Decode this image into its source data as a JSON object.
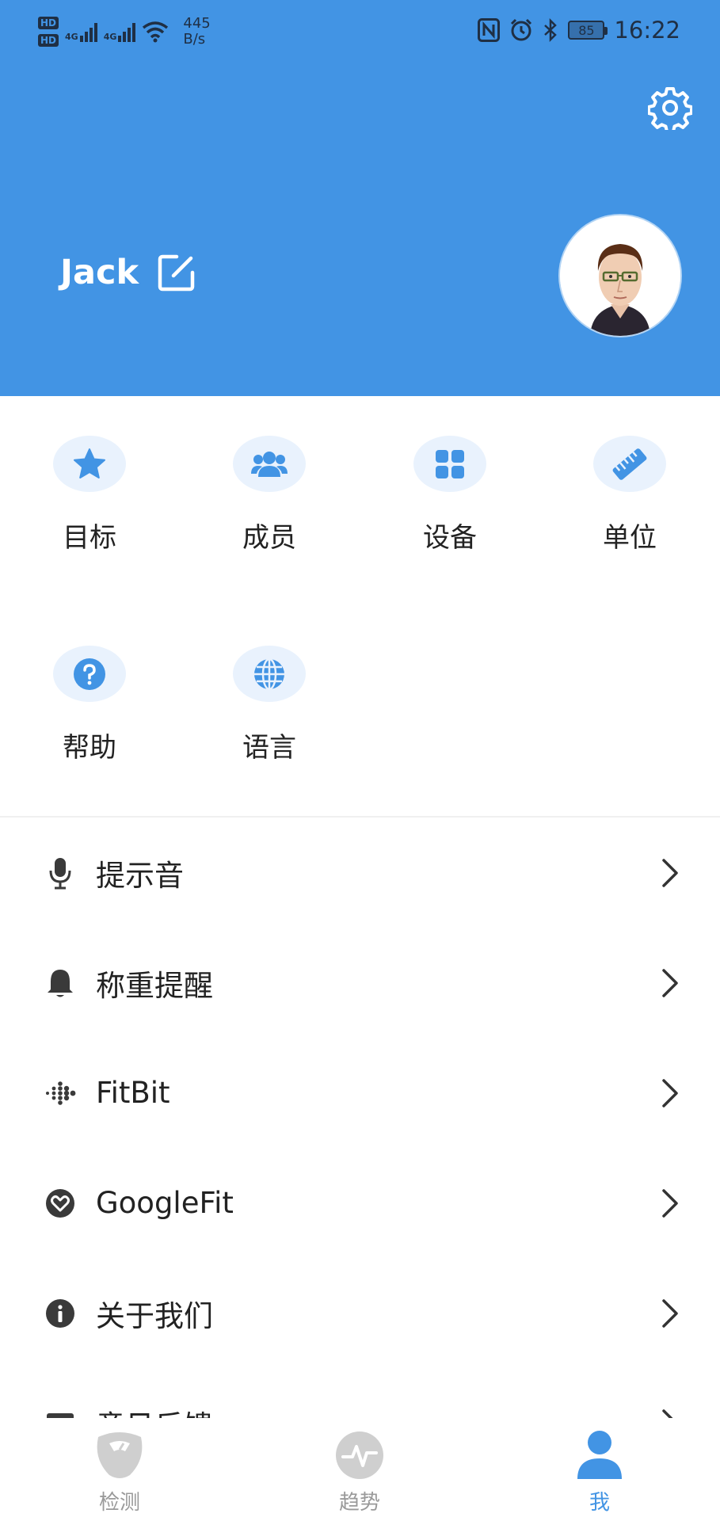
{
  "status_bar": {
    "hd1": "HD",
    "hd2": "HD",
    "net1": "4G",
    "net2": "4G",
    "speed_value": "445",
    "speed_unit": "B/s",
    "battery": "85",
    "time": "16:22"
  },
  "profile": {
    "username": "Jack"
  },
  "grid": {
    "items": [
      {
        "label": "目标",
        "icon": "star-icon"
      },
      {
        "label": "成员",
        "icon": "members-icon"
      },
      {
        "label": "设备",
        "icon": "devices-icon"
      },
      {
        "label": "单位",
        "icon": "ruler-icon"
      },
      {
        "label": "帮助",
        "icon": "help-icon"
      },
      {
        "label": "语言",
        "icon": "globe-icon"
      }
    ]
  },
  "list": {
    "items": [
      {
        "label": "提示音",
        "icon": "microphone-icon"
      },
      {
        "label": "称重提醒",
        "icon": "bell-icon"
      },
      {
        "label": "FitBit",
        "icon": "fitbit-icon"
      },
      {
        "label": "GoogleFit",
        "icon": "googlefit-icon"
      },
      {
        "label": "关于我们",
        "icon": "info-icon"
      },
      {
        "label": "意见反馈",
        "icon": "feedback-icon"
      }
    ]
  },
  "bottom_nav": {
    "items": [
      {
        "label": "检测",
        "icon": "scale-icon"
      },
      {
        "label": "趋势",
        "icon": "trend-icon"
      },
      {
        "label": "我",
        "icon": "person-icon"
      }
    ],
    "active_index": 2
  },
  "colors": {
    "primary": "#4294e4",
    "icon_bg": "#e9f2fd",
    "inactive": "#9a9a9a"
  }
}
